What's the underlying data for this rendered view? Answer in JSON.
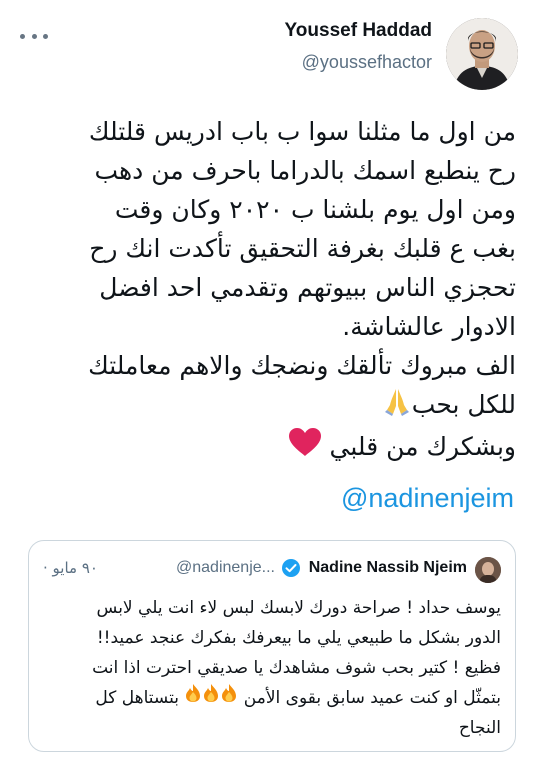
{
  "tweet": {
    "author_name": "Youssef Haddad",
    "author_handle": "@youssefhactor",
    "lines": [
      "من اول ما مثلنا سوا ب باب ادريس قلتلك",
      "رح ينطبع اسمك بالدراما باحرف من دهب",
      "ومن اول يوم بلشنا ب ٢٠٢٠ وكان وقت",
      "بغب ع قلبك بغرفة التحقيق تأكدت انك رح",
      "تحجزي الناس ببيوتهم وتقدمي احد افضل",
      "الادوار عالشاشة.",
      "الف مبروك تألقك ونضجك والاهم معاملتك",
      "للكل بحب",
      "وبشكرك من قلبي"
    ],
    "mention": "@nadinenjeim"
  },
  "quoted_tweet": {
    "author_name": "Nadine Nassib Njeim",
    "handle": "@nadinenje...",
    "date": "٩٠ مايو ·",
    "lines": [
      "يوسف حداد ! صراحة دورك لابسك لبس لاء انت يلي لابس",
      "الدور بشكل ما طبيعي يلي ما بيعرفك بفكرك عنجد عميد!!",
      "فظيع ! كتير بحب شوف مشاهدك يا صديقي احترت اذا انت",
      "بتمثّل او كنت عميد سابق بقوى الأمن",
      "بتستاهل كل",
      "النجاح"
    ]
  },
  "icons": {
    "more": "more-horizontal-icon",
    "avatar": "profile-avatar",
    "praying_hands": "folded-hands-emoji",
    "heart": "red-heart-emoji",
    "verified": "verified-badge-icon",
    "fire": "fire-emoji"
  },
  "colors": {
    "link": "#1b95e0",
    "secondary_text": "#5b7083",
    "border": "#ccd6dd",
    "verified": "#1da1f2",
    "heart": "#e0245e"
  }
}
